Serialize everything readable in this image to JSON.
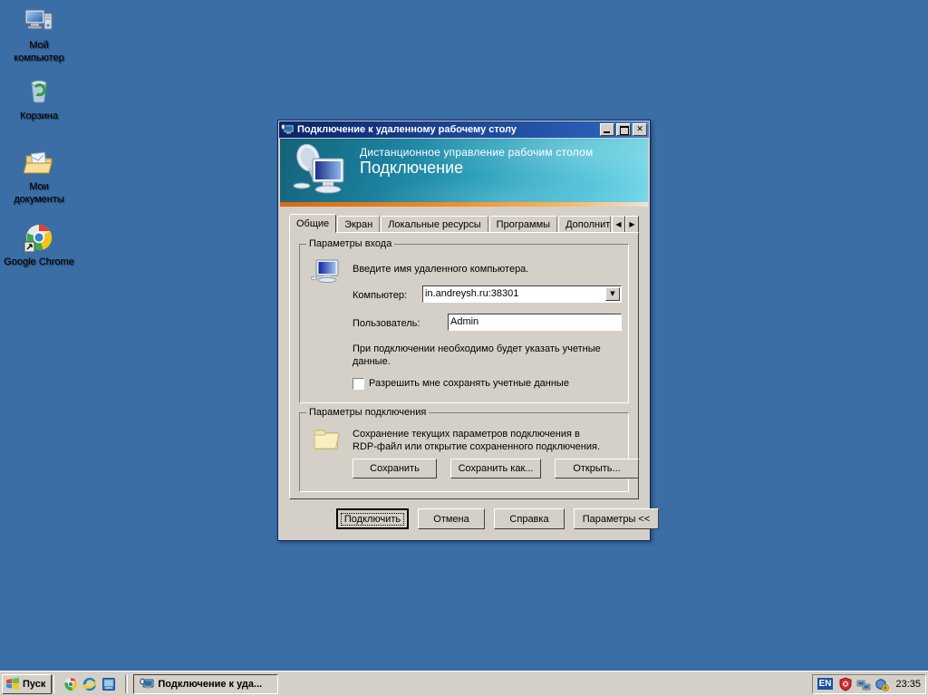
{
  "desktop": {
    "background_color": "#3a6ea5",
    "icons": [
      {
        "name": "my-computer",
        "label_line1": "Мой",
        "label_line2": "компьютер",
        "icon": "my-computer-icon"
      },
      {
        "name": "recycle-bin",
        "label_line1": "Корзина",
        "label_line2": "",
        "icon": "recycle-bin-icon"
      },
      {
        "name": "my-documents",
        "label_line1": "Мои",
        "label_line2": "документы",
        "icon": "my-documents-icon"
      },
      {
        "name": "google-chrome",
        "label_line1": "Google Chrome",
        "label_line2": "",
        "icon": "chrome-icon"
      }
    ]
  },
  "dialog": {
    "title": "Подключение к удаленному рабочему столу",
    "title_icon": "remote-desktop-icon",
    "window_buttons": {
      "minimize": "_",
      "maximize": "□",
      "close": "✕"
    },
    "banner": {
      "subtitle": "Дистанционное управление рабочим столом",
      "title": "Подключение",
      "icon": "remote-desktop-banner-icon",
      "gradient_from": "#14627a",
      "gradient_to": "#7ad8e8",
      "stripe_color": "#f08b25"
    },
    "tabs": [
      {
        "label": "Общие",
        "active": true
      },
      {
        "label": "Экран",
        "active": false
      },
      {
        "label": "Локальные ресурсы",
        "active": false
      },
      {
        "label": "Программы",
        "active": false
      },
      {
        "label": "Дополнительны",
        "active": false
      }
    ],
    "tab_scroll": {
      "left": "◀",
      "right": "▶"
    },
    "logon_group": {
      "title": "Параметры входа",
      "icon": "monitor-icon",
      "description": "Введите имя удаленного компьютера.",
      "computer_label": "Компьютер:",
      "computer_value": "in.andreysh.ru:38301",
      "computer_dropdown_arrow": "▼",
      "user_label": "Пользователь:",
      "user_value": "Admin",
      "note_line1": "При подключении необходимо будет указать учетные",
      "note_line2": "данные.",
      "checkbox_label": "Разрешить мне сохранять учетные данные",
      "checkbox_checked": false
    },
    "connection_group": {
      "title": "Параметры подключения",
      "icon": "folder-icon",
      "description_line1": "Сохранение текущих параметров подключения в",
      "description_line2": "RDP-файл или открытие сохраненного подключения.",
      "save_label": "Сохранить",
      "save_as_label": "Сохранить как...",
      "open_label": "Открыть..."
    },
    "footer": {
      "connect_label": "Подключить",
      "cancel_label": "Отмена",
      "help_label": "Справка",
      "options_label": "Параметры <<"
    }
  },
  "taskbar": {
    "start_label": "Пуск",
    "start_icon": "windows-flag-icon",
    "quick_launch": [
      {
        "name": "chrome",
        "icon": "chrome-icon"
      },
      {
        "name": "internet-explorer",
        "icon": "internet-explorer-icon"
      },
      {
        "name": "show-desktop",
        "icon": "show-desktop-icon"
      }
    ],
    "task_button": {
      "label": "Подключение к уда...",
      "icon": "remote-desktop-icon"
    },
    "tray": {
      "language": "EN",
      "icons": [
        {
          "name": "security-center",
          "icon": "red-shield-icon"
        },
        {
          "name": "network-connection",
          "icon": "network-icon"
        },
        {
          "name": "windows-update",
          "icon": "update-icon"
        }
      ],
      "clock": "23:35"
    }
  }
}
